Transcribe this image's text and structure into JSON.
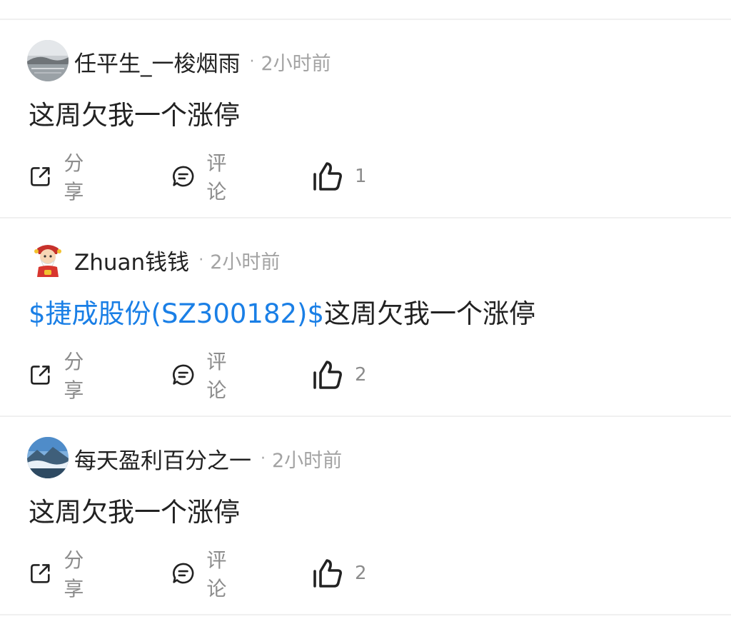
{
  "actions": {
    "share_label": "分享",
    "comment_label": "评论"
  },
  "posts": [
    {
      "username": "任平生_一梭烟雨",
      "time": "2小时前",
      "stock_tag": "",
      "text": "这周欠我一个涨停",
      "likes": "1",
      "avatar": "landscape-lake-photo"
    },
    {
      "username": "Zhuan钱钱",
      "time": "2小时前",
      "stock_tag": "$捷成股份(SZ300182)$",
      "text": "这周欠我一个涨停",
      "likes": "2",
      "avatar": "cartoon-fortune-god"
    },
    {
      "username": "每天盈利百分之一",
      "time": "2小时前",
      "stock_tag": "",
      "text": "这周欠我一个涨停",
      "likes": "2",
      "avatar": "mountain-sea-of-clouds-photo"
    }
  ],
  "colors": {
    "link": "#1a7fe6",
    "muted": "#a3a3a3",
    "text": "#222222",
    "divider": "#f0f0f0"
  }
}
